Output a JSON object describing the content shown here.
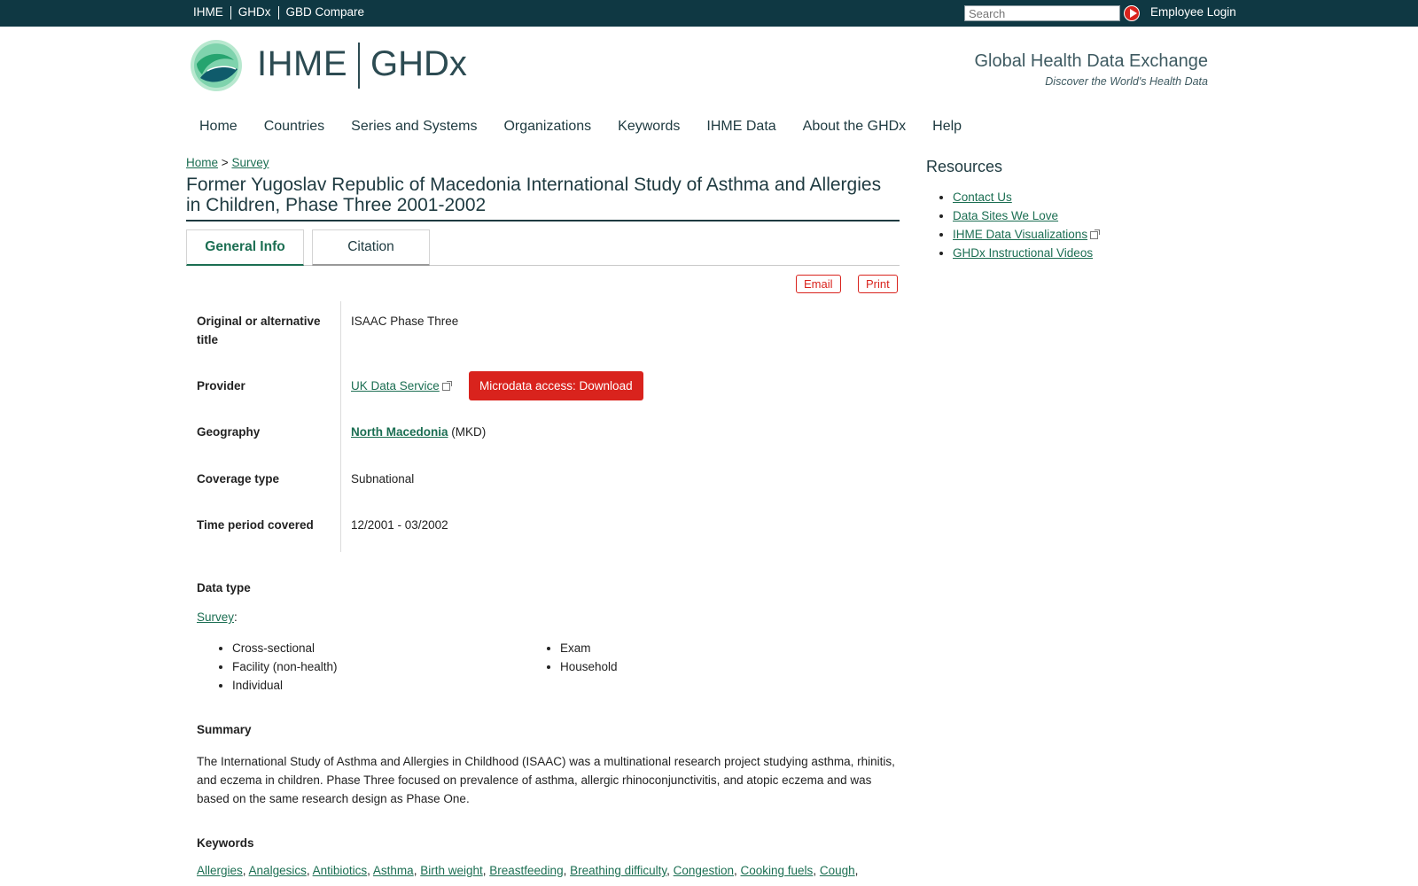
{
  "topbar": {
    "links": [
      "IHME",
      "GHDx",
      "GBD Compare"
    ],
    "search_placeholder": "Search",
    "employee_login": "Employee Login"
  },
  "header": {
    "logo_org": "IHME",
    "logo_site": "GHDx",
    "tagline": "Global Health Data Exchange",
    "subtagline": "Discover the World's Health Data",
    "colors": {
      "topbar": "#0f3843",
      "accent_green": "#1b6e52",
      "accent_red": "#d9231d"
    }
  },
  "mainnav": [
    "Home",
    "Countries",
    "Series and Systems",
    "Organizations",
    "Keywords",
    "IHME Data",
    "About the GHDx",
    "Help"
  ],
  "breadcrumb": {
    "home": "Home",
    "sep": ">",
    "current": "Survey"
  },
  "page_title": "Former Yugoslav Republic of Macedonia International Study of Asthma and Allergies in Children, Phase Three 2001-2002",
  "tabs": {
    "general": "General Info",
    "citation": "Citation"
  },
  "actions": {
    "email": "Email",
    "print": "Print"
  },
  "info": {
    "alt_title_label": "Original or alternative title",
    "alt_title": "ISAAC Phase Three",
    "provider_label": "Provider",
    "provider": "UK Data Service",
    "download_label": "Microdata access: Download",
    "geography_label": "Geography",
    "geography": "North Macedonia",
    "geography_code": "(MKD)",
    "coverage_label": "Coverage type",
    "coverage": "Subnational",
    "time_label": "Time period covered",
    "time": "12/2001 - 03/2002"
  },
  "data_type": {
    "title": "Data type",
    "survey_link": "Survey",
    "colon": ":",
    "left_items": [
      "Cross-sectional",
      "Facility (non-health)",
      "Individual"
    ],
    "right_items": [
      "Exam",
      "Household"
    ]
  },
  "summary": {
    "title": "Summary",
    "text": "The International Study of Asthma and Allergies in Childhood (ISAAC) was a multinational research project studying asthma, rhinitis, and eczema in children. Phase Three focused on prevalence of asthma, allergic rhinoconjunctivitis, and atopic eczema and was based on the same research design as Phase One."
  },
  "keywords": {
    "title": "Keywords",
    "items": [
      "Allergies",
      "Analgesics",
      "Antibiotics",
      "Asthma",
      "Birth weight",
      "Breastfeeding",
      "Breathing difficulty",
      "Congestion",
      "Cooking fuels",
      "Cough"
    ]
  },
  "sidebar": {
    "title": "Resources",
    "items": [
      "Contact Us",
      "Data Sites We Love",
      "IHME Data Visualizations",
      "GHDx Instructional Videos"
    ]
  }
}
